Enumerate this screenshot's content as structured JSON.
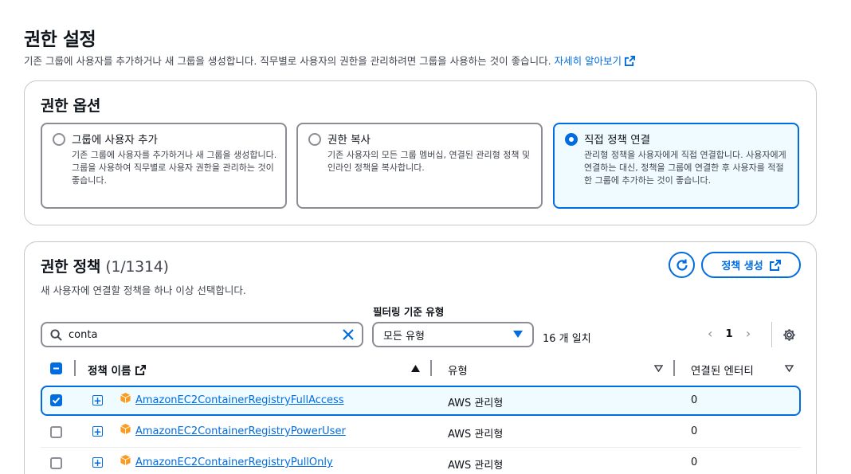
{
  "page": {
    "title": "권한 설정",
    "description": "기존 그룹에 사용자를 추가하거나 새 그룹을 생성합니다. 직무별로 사용자의 권한을 관리하려면 그룹을 사용하는 것이 좋습니다.",
    "learn_more": "자세히 알아보기"
  },
  "options": {
    "title": "권한 옵션",
    "tiles": [
      {
        "label": "그룹에 사용자 추가",
        "desc": "기존 그룹에 사용자를 추가하거나 새 그룹을 생성합니다. 그룹을 사용하여 직무별로 사용자 권한을 관리하는 것이 좋습니다.",
        "selected": false
      },
      {
        "label": "권한 복사",
        "desc": "기존 사용자의 모든 그룹 멤버십, 연결된 관리형 정책 및 인라인 정책을 복사합니다.",
        "selected": false
      },
      {
        "label": "직접 정책 연결",
        "desc": "관리형 정책을 사용자에게 직접 연결합니다. 사용자에게 연결하는 대신, 정책을 그룹에 연결한 후 사용자를 적절한 그룹에 추가하는 것이 좋습니다.",
        "selected": true
      }
    ]
  },
  "policies": {
    "title": "권한 정책",
    "count": "(1/1314)",
    "subtitle": "새 사용자에 연결할 정책을 하나 이상 선택합니다.",
    "create_button": "정책 생성",
    "filter_label": "필터링 기준 유형",
    "search_value": "conta",
    "type_select": "모든 유형",
    "match_count": "16 개 일치",
    "current_page": "1",
    "columns": {
      "name": "정책 이름",
      "type": "유형",
      "entities": "연결된 엔터티"
    },
    "rows": [
      {
        "name": "AmazonEC2ContainerRegistryFullAccess",
        "type": "AWS 관리형",
        "entities": "0",
        "checked": true
      },
      {
        "name": "AmazonEC2ContainerRegistryPowerUser",
        "type": "AWS 관리형",
        "entities": "0",
        "checked": false
      },
      {
        "name": "AmazonEC2ContainerRegistryPullOnly",
        "type": "AWS 관리형",
        "entities": "0",
        "checked": false
      }
    ]
  },
  "colors": {
    "accent": "#006ce0",
    "text": "#0f141a",
    "secondary_text": "#424650",
    "border": "#8c8c94",
    "selected_bg": "#f0fbff",
    "package_icon": "#f89c24"
  }
}
